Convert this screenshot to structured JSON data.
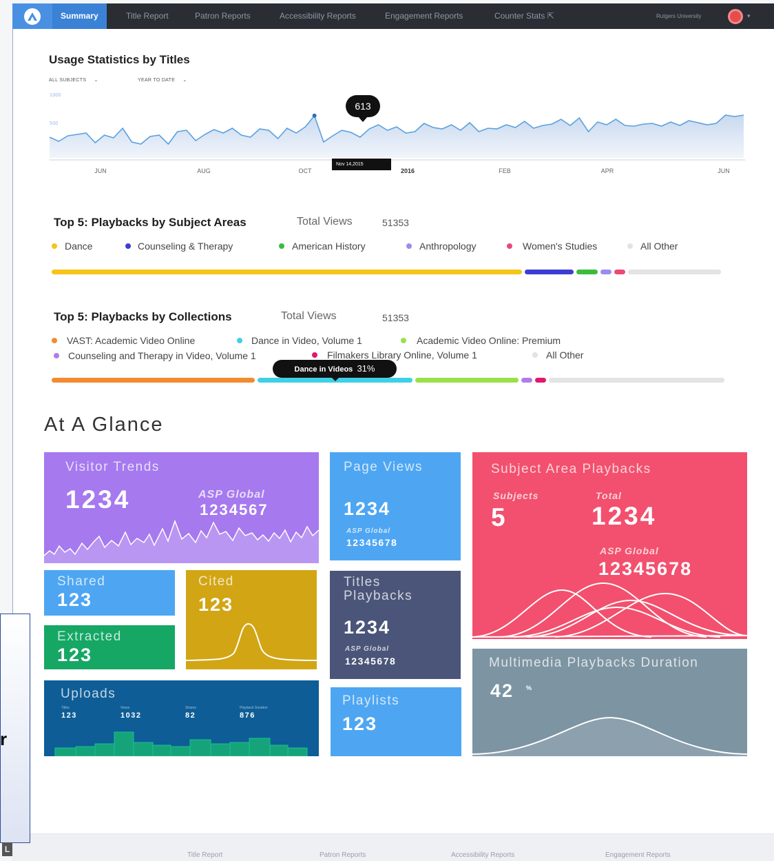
{
  "nav": {
    "tabs": [
      "Summary",
      "Title Report",
      "Patron Reports",
      "Accessibility Reports",
      "Engagement Reports",
      "Counter Stats"
    ],
    "active_tab": "Summary",
    "university": "Rutgers University",
    "accent": "#3b82d6"
  },
  "usage": {
    "title": "Usage Statistics by Titles",
    "filter_subjects": "ALL SUBJECTS",
    "filter_period": "YEAR TO DATE",
    "tooltip_value": "613",
    "tooltip_date": "Nov 14,2015",
    "y_tick_top": "1000",
    "y_tick_mid": "500",
    "x_labels": [
      "JUN",
      "AUG",
      "OCT",
      "2016",
      "FEB",
      "APR",
      "JUN"
    ]
  },
  "chart_data": {
    "type": "area",
    "title": "Usage Statistics by Titles",
    "y_ticks": [
      "1000",
      "500"
    ],
    "x_tick_labels": [
      "JUN",
      "AUG",
      "OCT",
      "2016",
      "FEB",
      "APR",
      "JUN"
    ],
    "series": [
      {
        "values": [
          300,
          240,
          320,
          340,
          360,
          220,
          330,
          290,
          430,
          230,
          200,
          310,
          330,
          200,
          380,
          400,
          250,
          340,
          410,
          360,
          430,
          330,
          300,
          420,
          400,
          280,
          430,
          360,
          450,
          613,
          230,
          320,
          400,
          370,
          300,
          420,
          480,
          400,
          450,
          360,
          380,
          500,
          440,
          420,
          480,
          400,
          510,
          380,
          430,
          420,
          480,
          440,
          530,
          430,
          470,
          490,
          560,
          470,
          580,
          380,
          520,
          480,
          560,
          470,
          460,
          490,
          500,
          460,
          520,
          470,
          540,
          510,
          480,
          500,
          620,
          600,
          620
        ]
      }
    ],
    "highlight": {
      "value": 613,
      "label": "Nov 14,2015"
    }
  },
  "subjects": {
    "title": "Top 5: Playbacks by Subject Areas",
    "total_label": "Total Views",
    "total": "51353",
    "items": [
      {
        "name": "Dance",
        "color": "#f5c518",
        "share": 0.69
      },
      {
        "name": "Counseling & Therapy",
        "color": "#3d3dd6",
        "share": 0.075
      },
      {
        "name": "American History",
        "color": "#3dbb3d",
        "share": 0.035
      },
      {
        "name": "Anthropology",
        "color": "#9b8bef",
        "share": 0.02
      },
      {
        "name": "Women's Studies",
        "color": "#e84a7a",
        "share": 0.02
      },
      {
        "name": "All Other",
        "color": "#e3e3e3",
        "share": 0.14
      }
    ]
  },
  "collections": {
    "title": "Top 5: Playbacks by Collections",
    "total_label": "Total Views",
    "total": "51353",
    "tooltip_name": "Dance in Videos",
    "tooltip_pct": "31%",
    "items": [
      {
        "name": "VAST: Academic Video Online",
        "color": "#f28b30",
        "share": 0.3
      },
      {
        "name": "Dance in Video, Volume 1",
        "color": "#3fd0e6",
        "share": 0.23
      },
      {
        "name": "Academic Video Online: Premium",
        "color": "#9ae049",
        "share": 0.155
      },
      {
        "name": "Counseling and Therapy in Video, Volume 1",
        "color": "#b07de6",
        "share": 0.02
      },
      {
        "name": "Filmakers Library Online, Volume 1",
        "color": "#e0186b",
        "share": 0.02
      },
      {
        "name": "All Other",
        "color": "#e3e3e3",
        "share": 0.26
      }
    ]
  },
  "glance": {
    "title": "At A Glance",
    "visitor": {
      "title": "Visitor Trends",
      "value": "1234",
      "global_label": "ASP Global",
      "global_value": "1234567"
    },
    "pageviews": {
      "title": "Page Views",
      "value": "1234",
      "global_label": "ASP Global",
      "global_value": "12345678"
    },
    "subject_playbacks": {
      "title": "Subject Area Playbacks",
      "subjects_label": "Subjects",
      "subjects_value": "5",
      "total_label": "Total",
      "total_value": "1234",
      "global_label": "ASP Global",
      "global_value": "12345678"
    },
    "shared": {
      "title": "Shared",
      "value": "123"
    },
    "cited": {
      "title": "Cited",
      "value": "123"
    },
    "extracted": {
      "title": "Extracted",
      "value": "123"
    },
    "titles_playbacks": {
      "title_line1": "Titles",
      "title_line2": "Playbacks",
      "value": "1234",
      "global_label": "ASP Global",
      "global_value": "12345678"
    },
    "duration": {
      "title": "Multimedia Playbacks Duration",
      "value": "42",
      "unit": "%"
    },
    "uploads": {
      "title": "Uploads",
      "stats": [
        {
          "label": "Titles",
          "value": "123"
        },
        {
          "label": "Views",
          "value": "1032"
        },
        {
          "label": "Shares",
          "value": "82"
        },
        {
          "label": "Playback Duration",
          "value": "876"
        }
      ]
    },
    "playlists": {
      "title": "Playlists",
      "value": "123"
    }
  },
  "footer": {
    "links": [
      "Title Report",
      "Patron Reports",
      "Accessibility Reports",
      "Engagement Reports"
    ]
  },
  "sidebox": {
    "text": "r"
  },
  "corner": {
    "text": "L"
  }
}
